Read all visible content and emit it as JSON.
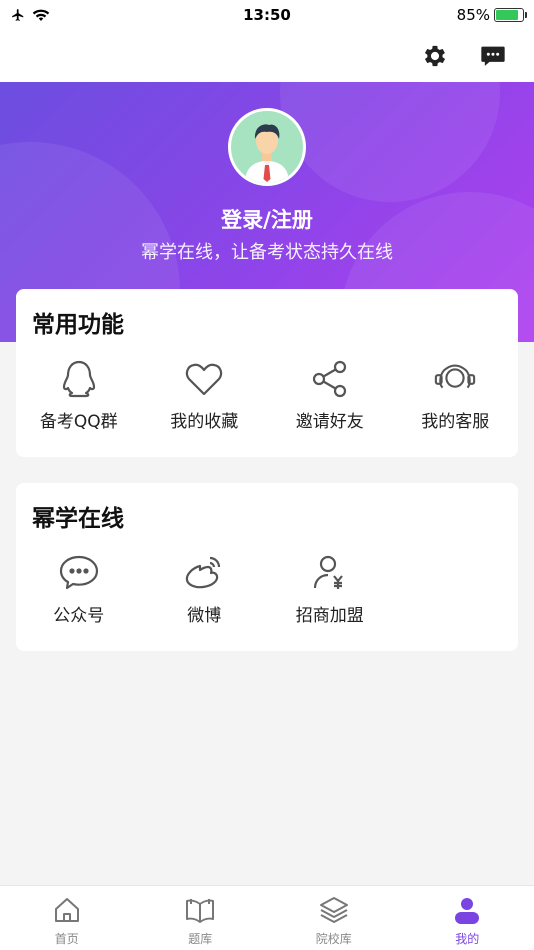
{
  "status": {
    "time": "13:50",
    "battery": "85%",
    "battery_level": 0.85
  },
  "header": {
    "settings_icon": "gear-icon",
    "message_icon": "chat-bubble-icon"
  },
  "profile": {
    "title": "登录/注册",
    "subtitle": "幂学在线，让备考状态持久在线",
    "gradient": [
      "#6c4ee0",
      "#b040f0"
    ]
  },
  "common": {
    "title": "常用功能",
    "items": [
      {
        "label": "备考QQ群",
        "icon": "qq-icon"
      },
      {
        "label": "我的收藏",
        "icon": "heart-icon"
      },
      {
        "label": "邀请好友",
        "icon": "share-icon"
      },
      {
        "label": "我的客服",
        "icon": "headset-icon"
      }
    ]
  },
  "mixue": {
    "title": "幂学在线",
    "items": [
      {
        "label": "公众号",
        "icon": "wechat-icon"
      },
      {
        "label": "微博",
        "icon": "weibo-icon"
      },
      {
        "label": "招商加盟",
        "icon": "partner-icon"
      }
    ]
  },
  "tabs": [
    {
      "label": "首页",
      "icon": "home-icon"
    },
    {
      "label": "题库",
      "icon": "book-icon"
    },
    {
      "label": "院校库",
      "icon": "layers-icon"
    },
    {
      "label": "我的",
      "icon": "user-icon",
      "active": true
    }
  ],
  "colors": {
    "accent": "#7a44e2",
    "icon_gray": "#555555"
  }
}
